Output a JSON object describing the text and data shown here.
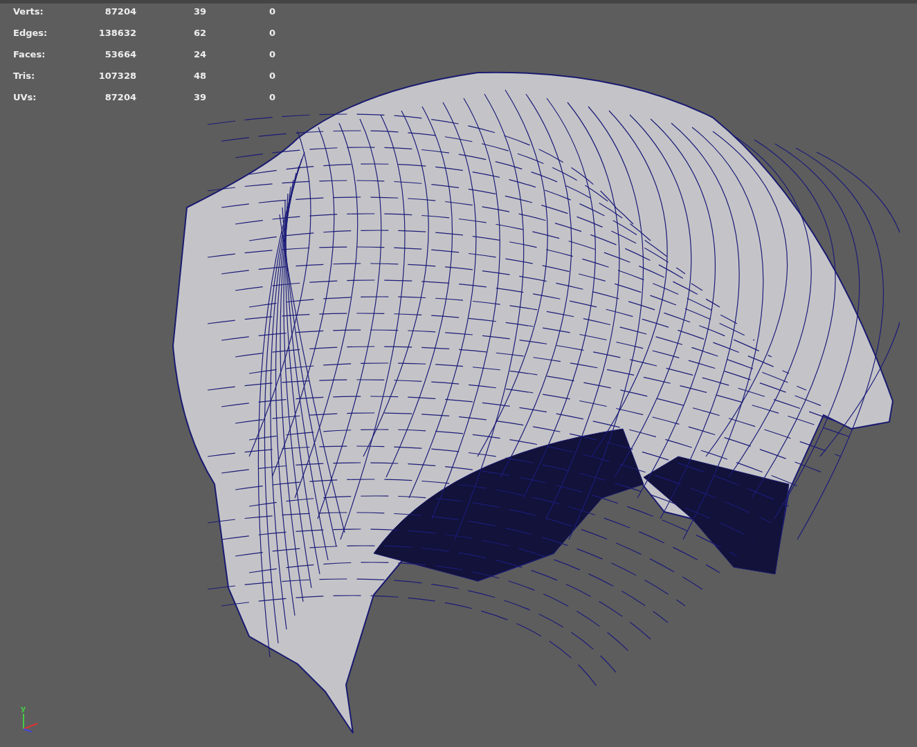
{
  "hud_stats": [
    {
      "label": "Verts:",
      "values": [
        "87204",
        "39",
        "0"
      ]
    },
    {
      "label": "Edges:",
      "values": [
        "138632",
        "62",
        "0"
      ]
    },
    {
      "label": "Faces:",
      "values": [
        "53664",
        "24",
        "0"
      ]
    },
    {
      "label": "Tris:",
      "values": [
        "107328",
        "48",
        "0"
      ]
    },
    {
      "label": "UVs:",
      "values": [
        "87204",
        "39",
        "0"
      ]
    }
  ],
  "axis_gizmo": {
    "labels": [
      "y"
    ]
  }
}
